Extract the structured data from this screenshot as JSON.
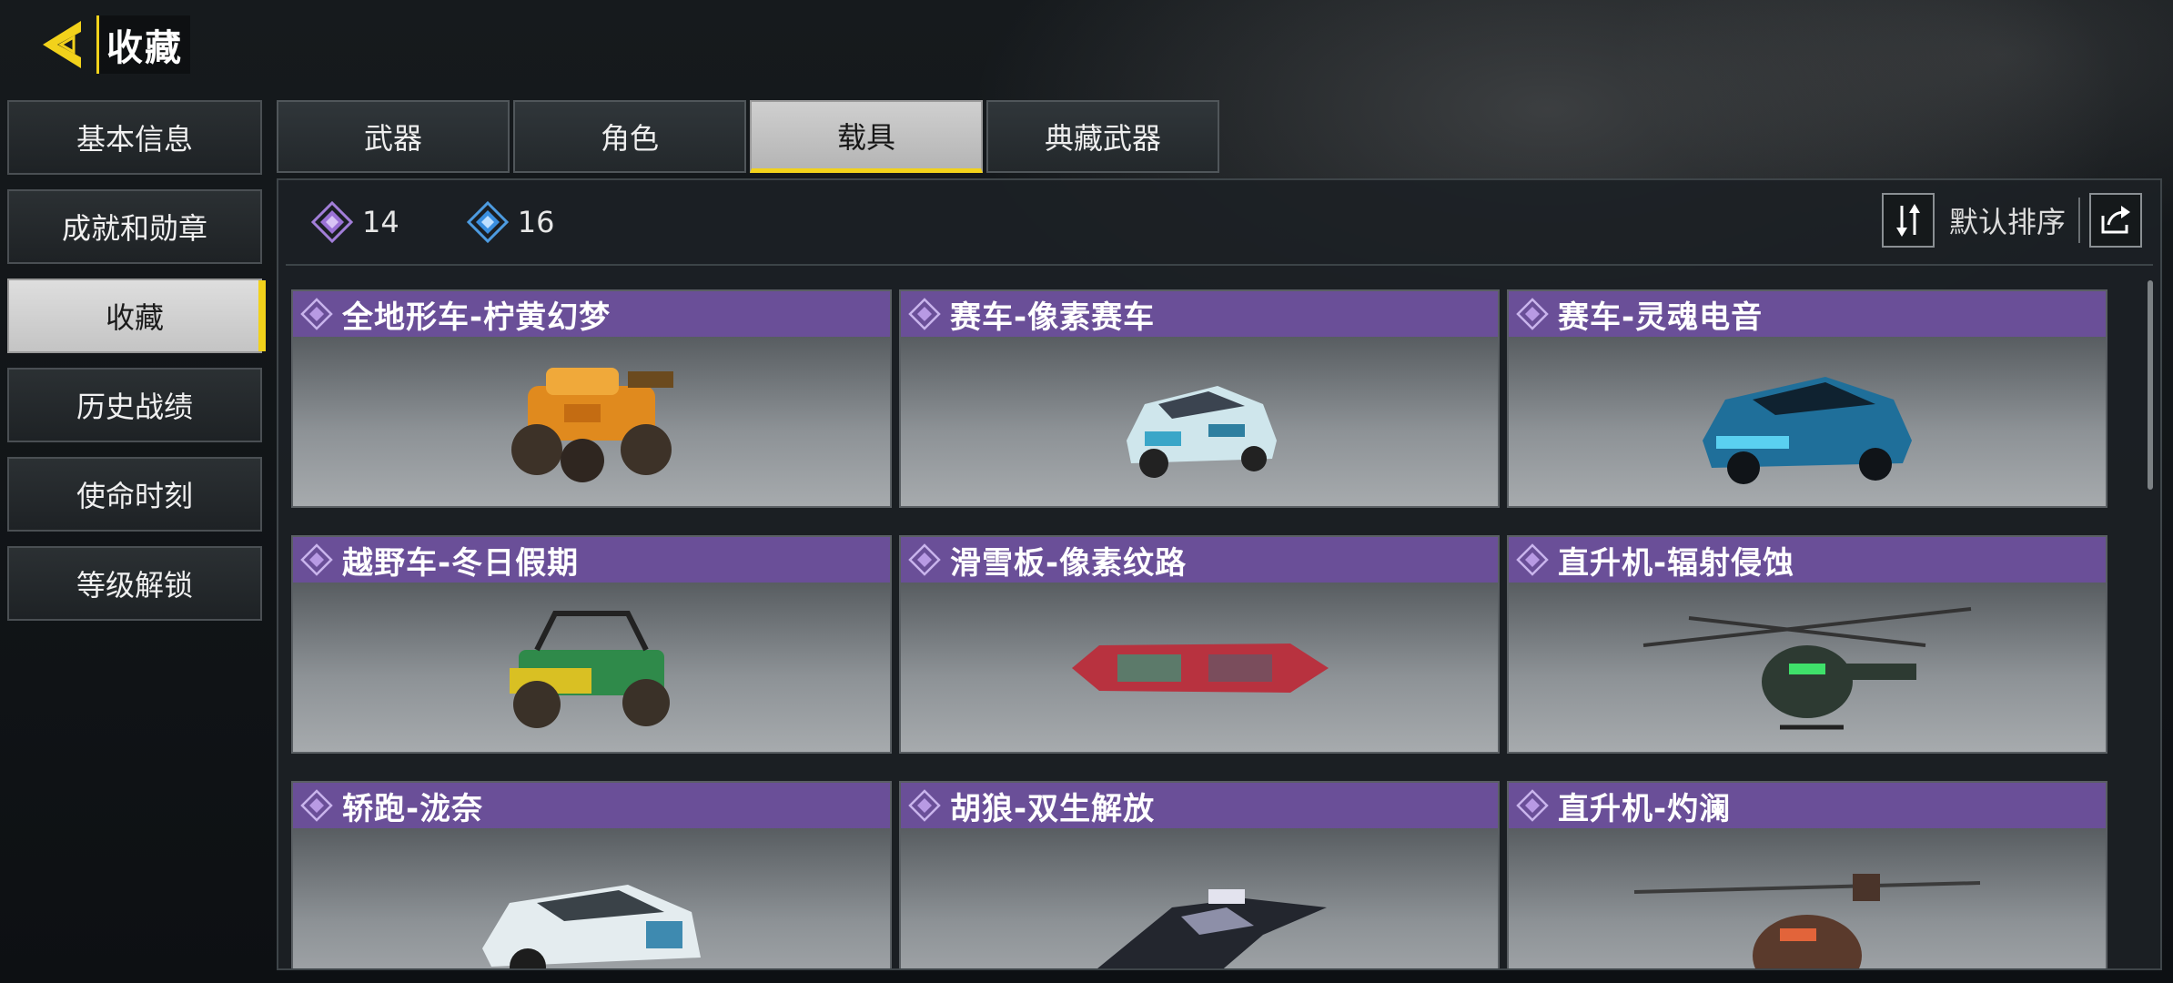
{
  "header": {
    "title": "收藏",
    "back_icon": "back-arrow-icon"
  },
  "nav": {
    "items": [
      {
        "label": "基本信息",
        "active": false
      },
      {
        "label": "成就和勋章",
        "active": false
      },
      {
        "label": "收藏",
        "active": true
      },
      {
        "label": "历史战绩",
        "active": false
      },
      {
        "label": "使命时刻",
        "active": false
      },
      {
        "label": "等级解锁",
        "active": false
      }
    ]
  },
  "tabs": [
    {
      "label": "武器",
      "active": false
    },
    {
      "label": "角色",
      "active": false
    },
    {
      "label": "载具",
      "active": true
    },
    {
      "label": "典藏武器",
      "active": false
    }
  ],
  "stats": {
    "purple_count": "14",
    "blue_count": "16"
  },
  "sort": {
    "label": "默认排序"
  },
  "colors": {
    "accent": "#f2d21b",
    "rarity_purple": "#6a4f98"
  },
  "cards": [
    {
      "name": "全地形车-柠黄幻梦",
      "icon": "atv-orange"
    },
    {
      "name": "赛车-像素赛车",
      "icon": "car-pixel"
    },
    {
      "name": "赛车-灵魂电音",
      "icon": "car-blue"
    },
    {
      "name": "越野车-冬日假期",
      "icon": "buggy-green"
    },
    {
      "name": "滑雪板-像素纹路",
      "icon": "snowboard"
    },
    {
      "name": "直升机-辐射侵蚀",
      "icon": "heli-green"
    },
    {
      "name": "轿跑-泷奈",
      "icon": "coupe-white"
    },
    {
      "name": "胡狼-双生解放",
      "icon": "jet-camo"
    },
    {
      "name": "直升机-灼澜",
      "icon": "heli-orange"
    }
  ]
}
